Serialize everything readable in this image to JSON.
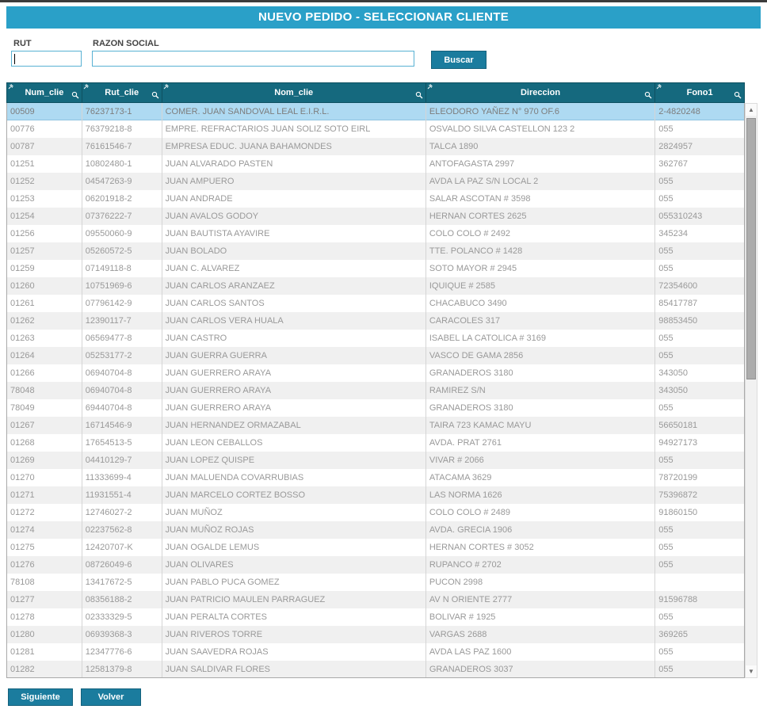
{
  "window": {
    "title": "NUEVO PEDIDO - SELECCIONAR CLIENTE"
  },
  "form": {
    "rut_label": "RUT",
    "razon_label": "RAZON SOCIAL",
    "rut_value": "",
    "razon_value": "",
    "rut_placeholder": "",
    "razon_placeholder": "",
    "buscar_label": "Buscar"
  },
  "icons": {
    "header_pin": "pin-icon",
    "header_search": "magnifier-icon",
    "up": "▲",
    "down": "▼"
  },
  "colors": {
    "titlebar": "#2aa0c8",
    "grid_header": "#15697e",
    "button": "#1b7c9e",
    "selected_row": "#aedaf2",
    "stripe_row": "#f0f0f0"
  },
  "table": {
    "columns": [
      {
        "label": "Num_clie"
      },
      {
        "label": "Rut_clie"
      },
      {
        "label": "Nom_clie"
      },
      {
        "label": "Direccion"
      },
      {
        "label": "Fono1"
      }
    ],
    "selected_row_index": 0,
    "rows": [
      [
        "00509",
        "76237173-1",
        "COMER. JUAN SANDOVAL LEAL E.I.R.L.",
        "ELEODORO YAÑEZ N° 970 OF.6",
        "2-4820248"
      ],
      [
        "00776",
        "76379218-8",
        "EMPRE. REFRACTARIOS JUAN SOLIZ SOTO EIRL",
        "OSVALDO SILVA CASTELLON 123 2",
        "055"
      ],
      [
        "00787",
        "76161546-7",
        "EMPRESA EDUC. JUANA BAHAMONDES",
        "TALCA 1890",
        "2824957"
      ],
      [
        "01251",
        "10802480-1",
        "JUAN ALVARADO PASTEN",
        "ANTOFAGASTA 2997",
        "362767"
      ],
      [
        "01252",
        "04547263-9",
        "JUAN AMPUERO",
        "AVDA LA PAZ S/N LOCAL 2",
        "055"
      ],
      [
        "01253",
        "06201918-2",
        "JUAN ANDRADE",
        "SALAR ASCOTAN # 3598",
        "055"
      ],
      [
        "01254",
        "07376222-7",
        "JUAN AVALOS GODOY",
        "HERNAN CORTES 2625",
        "055310243"
      ],
      [
        "01256",
        "09550060-9",
        "JUAN BAUTISTA AYAVIRE",
        "COLO COLO # 2492",
        "345234"
      ],
      [
        "01257",
        "05260572-5",
        "JUAN BOLADO",
        "TTE. POLANCO # 1428",
        "055"
      ],
      [
        "01259",
        "07149118-8",
        "JUAN C. ALVAREZ",
        "SOTO MAYOR # 2945",
        "055"
      ],
      [
        "01260",
        "10751969-6",
        "JUAN CARLOS ARANZAEZ",
        "IQUIQUE # 2585",
        "72354600"
      ],
      [
        "01261",
        "07796142-9",
        "JUAN CARLOS SANTOS",
        "CHACABUCO 3490",
        "85417787"
      ],
      [
        "01262",
        "12390117-7",
        "JUAN CARLOS VERA HUALA",
        "CARACOLES 317",
        "98853450"
      ],
      [
        "01263",
        "06569477-8",
        "JUAN CASTRO",
        "ISABEL LA CATOLICA # 3169",
        "055"
      ],
      [
        "01264",
        "05253177-2",
        "JUAN GUERRA GUERRA",
        "VASCO DE GAMA 2856",
        "055"
      ],
      [
        "01266",
        "06940704-8",
        "JUAN GUERRERO ARAYA",
        "GRANADEROS 3180",
        "343050"
      ],
      [
        "78048",
        "06940704-8",
        "JUAN GUERRERO ARAYA",
        "RAMIREZ S/N",
        "343050"
      ],
      [
        "78049",
        "69440704-8",
        "JUAN GUERRERO ARAYA",
        "GRANADEROS 3180",
        "055"
      ],
      [
        "01267",
        "16714546-9",
        "JUAN HERNANDEZ ORMAZABAL",
        "TAIRA 723 KAMAC MAYU",
        "56650181"
      ],
      [
        "01268",
        "17654513-5",
        "JUAN LEON CEBALLOS",
        "AVDA. PRAT 2761",
        "94927173"
      ],
      [
        "01269",
        "04410129-7",
        "JUAN LOPEZ QUISPE",
        "VIVAR # 2066",
        "055"
      ],
      [
        "01270",
        "11333699-4",
        "JUAN MALUENDA COVARRUBIAS",
        "ATACAMA 3629",
        "78720199"
      ],
      [
        "01271",
        "11931551-4",
        "JUAN MARCELO CORTEZ BOSSO",
        "LAS NORMA 1626",
        "75396872"
      ],
      [
        "01272",
        "12746027-2",
        "JUAN MUÑOZ",
        "COLO COLO # 2489",
        "91860150"
      ],
      [
        "01274",
        "02237562-8",
        "JUAN MUÑOZ ROJAS",
        "AVDA. GRECIA 1906",
        "055"
      ],
      [
        "01275",
        "12420707-K",
        "JUAN OGALDE LEMUS",
        "HERNAN CORTES # 3052",
        "055"
      ],
      [
        "01276",
        "08726049-6",
        "JUAN OLIVARES",
        "RUPANCO # 2702",
        "055"
      ],
      [
        "78108",
        "13417672-5",
        "JUAN PABLO PUCA GOMEZ",
        "PUCON 2998",
        ""
      ],
      [
        "01277",
        "08356188-2",
        "JUAN PATRICIO MAULEN PARRAGUEZ",
        "AV N ORIENTE 2777",
        "91596788"
      ],
      [
        "01278",
        "02333329-5",
        "JUAN PERALTA CORTES",
        "BOLIVAR # 1925",
        "055"
      ],
      [
        "01280",
        "06939368-3",
        "JUAN RIVEROS TORRE",
        "VARGAS 2688",
        "369265"
      ],
      [
        "01281",
        "12347776-6",
        "JUAN SAAVEDRA ROJAS",
        "AVDA LAS PAZ 1600",
        "055"
      ],
      [
        "01282",
        "12581379-8",
        "JUAN SALDIVAR FLORES",
        "GRANADEROS 3037",
        "055"
      ]
    ]
  },
  "footer": {
    "siguiente_label": "Siguiente",
    "volver_label": "Volver"
  }
}
